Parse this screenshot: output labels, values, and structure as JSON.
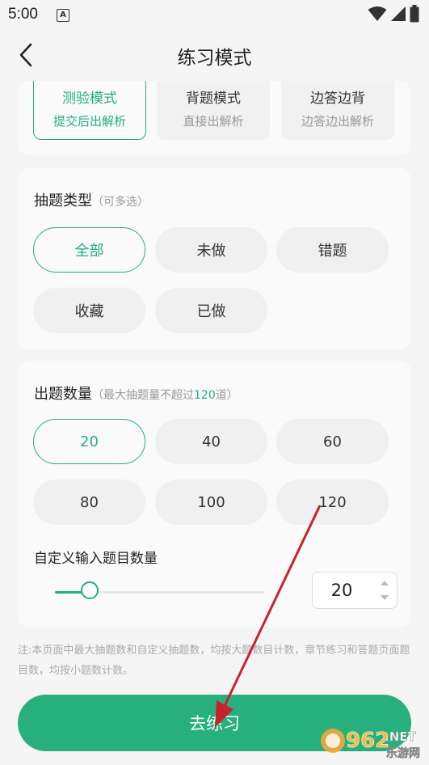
{
  "status_bar": {
    "time": "5:00",
    "notification_icon_letter": "A",
    "icons": [
      "wifi-icon",
      "signal-icon",
      "battery-icon"
    ]
  },
  "header": {
    "title": "练习模式"
  },
  "modes": [
    {
      "title": "测验模式",
      "subtitle": "提交后出解析",
      "selected": true
    },
    {
      "title": "背题模式",
      "subtitle": "直接出解析",
      "selected": false
    },
    {
      "title": "边答边背",
      "subtitle": "边答边出解析",
      "selected": false
    }
  ],
  "question_type": {
    "title": "抽题类型",
    "hint": "（可多选）",
    "options": [
      {
        "label": "全部",
        "selected": true
      },
      {
        "label": "未做",
        "selected": false
      },
      {
        "label": "错题",
        "selected": false
      },
      {
        "label": "收藏",
        "selected": false
      },
      {
        "label": "已做",
        "selected": false
      }
    ]
  },
  "question_count": {
    "title": "出题数量",
    "hint_prefix": "（最大抽题量不超过",
    "hint_value": "120",
    "hint_suffix": "道）",
    "options": [
      {
        "label": "20",
        "selected": true
      },
      {
        "label": "40",
        "selected": false
      },
      {
        "label": "60",
        "selected": false
      },
      {
        "label": "80",
        "selected": false
      },
      {
        "label": "100",
        "selected": false
      },
      {
        "label": "120",
        "selected": false
      }
    ],
    "custom_label": "自定义输入题目数量",
    "custom_value": "20",
    "slider_fraction": 0.17
  },
  "note": "注:本页面中最大抽题数和自定义抽题数，均按大题数目计数，章节练习和答题页面题目数，均按小题数计数。",
  "go_button": {
    "label": "去练习"
  },
  "watermark": {
    "text_number": "962",
    "text_net": ".NET",
    "text_cn": "乐游网"
  },
  "colors": {
    "accent": "#22b07d",
    "button": "#27b07d",
    "annotation_arrow": "#c8232c"
  }
}
